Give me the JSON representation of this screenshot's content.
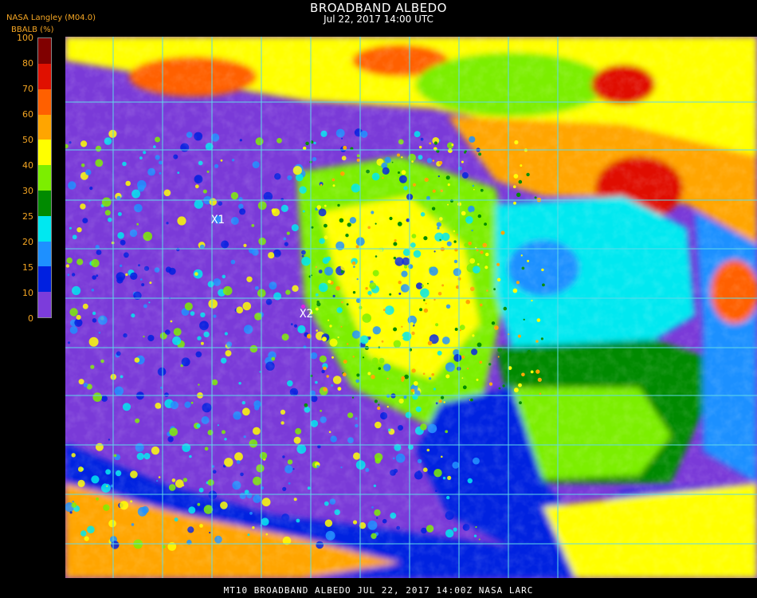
{
  "title": "BROADBAND ALBEDO",
  "subtitle": "Jul 22, 2017 14:00 UTC",
  "organization": "NASA Langley (M04.0)",
  "unit_label": "BBALB (%)",
  "colorbar": {
    "ticks": [
      "0",
      "10",
      "15",
      "20",
      "25",
      "30",
      "40",
      "50",
      "60",
      "70",
      "80",
      "100"
    ],
    "colors": [
      "#7c3cdb",
      "#0020e0",
      "#1e90ff",
      "#00e8f0",
      "#008a00",
      "#7cee00",
      "#ffff00",
      "#ffa500",
      "#ff6000",
      "#e01000",
      "#800000"
    ]
  },
  "markers": [
    {
      "label": "X1"
    },
    {
      "label": "X2"
    }
  ],
  "grid_color": "#5fd8e8",
  "footer": "MT10  BROADBAND ALBEDO   JUL 22, 2017 14:00Z   NASA LARC"
}
